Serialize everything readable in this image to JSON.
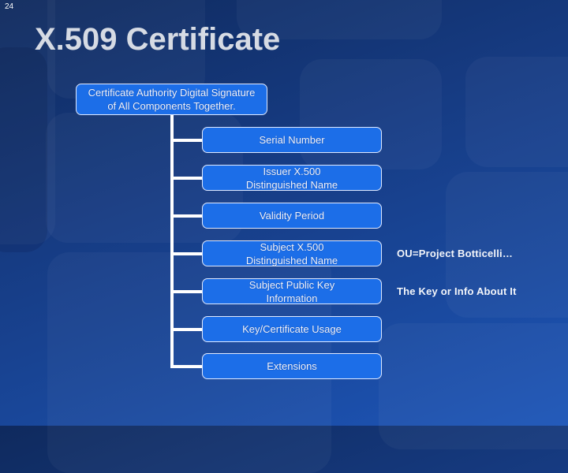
{
  "slide": {
    "number": "24",
    "title": "X.509 Certificate"
  },
  "diagram": {
    "root": {
      "label": "Certificate Authority Digital Signature\nof All Components Together."
    },
    "fields": [
      {
        "label": "Serial Number"
      },
      {
        "label": "Issuer X.500\nDistinguished Name"
      },
      {
        "label": "Validity Period"
      },
      {
        "label": "Subject X.500\nDistinguished Name",
        "annotation": "OU=Project Botticelli…"
      },
      {
        "label": "Subject Public Key\nInformation",
        "annotation": "The Key or Info About It"
      },
      {
        "label": "Key/Certificate Usage"
      },
      {
        "label": "Extensions"
      }
    ]
  },
  "colors": {
    "box_fill": "#1c6ee8",
    "box_border": "#dfe9ff",
    "connector": "#ffffff",
    "background": "#163b82",
    "title": "#d6dbe4"
  }
}
